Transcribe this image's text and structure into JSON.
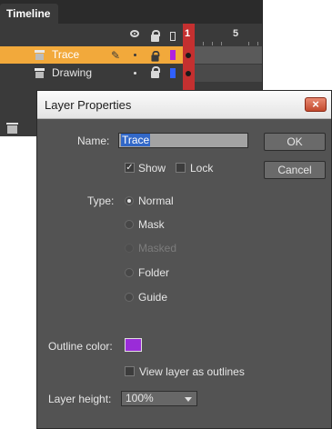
{
  "timeline": {
    "tab_label": "Timeline",
    "frame_numbers": [
      "1",
      "5"
    ],
    "layers": [
      {
        "name": "Trace",
        "selected": true,
        "color": "#b020e0"
      },
      {
        "name": "Drawing",
        "selected": false,
        "color": "#3060ff"
      }
    ]
  },
  "dialog": {
    "title": "Layer Properties",
    "close_label": "×",
    "name_label": "Name:",
    "name_value": "Trace",
    "show_label": "Show",
    "show_checked": true,
    "lock_label": "Lock",
    "lock_checked": false,
    "ok_label": "OK",
    "cancel_label": "Cancel",
    "type_label": "Type:",
    "type_options": [
      {
        "label": "Normal",
        "selected": true,
        "enabled": true
      },
      {
        "label": "Mask",
        "selected": false,
        "enabled": true
      },
      {
        "label": "Masked",
        "selected": false,
        "enabled": false
      },
      {
        "label": "Folder",
        "selected": false,
        "enabled": true
      },
      {
        "label": "Guide",
        "selected": false,
        "enabled": true
      }
    ],
    "outline_color_label": "Outline color:",
    "outline_color": "#9a2cd8",
    "view_outlines_label": "View layer as outlines",
    "view_outlines_checked": false,
    "layer_height_label": "Layer height:",
    "layer_height_value": "100%"
  }
}
